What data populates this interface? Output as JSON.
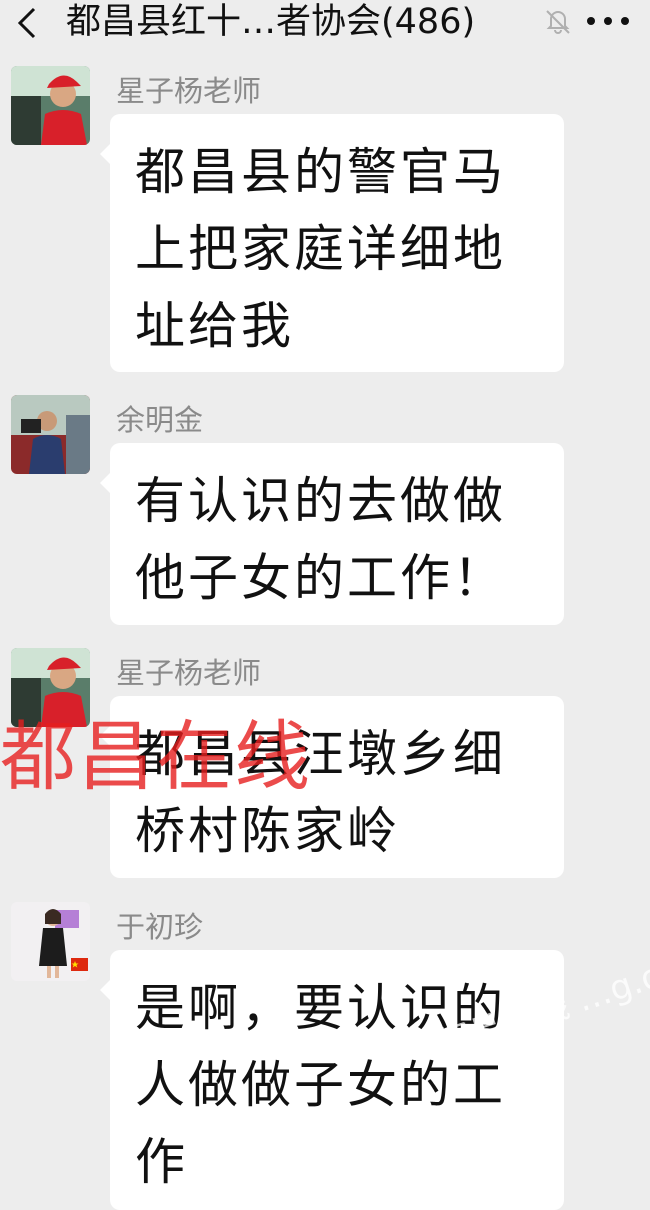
{
  "header": {
    "title": "都昌县红十…者协会(486)",
    "back_icon": "chevron-left-icon",
    "mute_icon": "bell-off-icon",
    "more_icon": "more-dots-icon"
  },
  "messages": [
    {
      "sender": "星子杨老师",
      "avatar": "avatar-man-red-cap",
      "text": "都昌县的警官马上把家庭详细地址给我"
    },
    {
      "sender": "余明金",
      "avatar": "avatar-man-camera",
      "text": "有认识的去做做他子女的工作！"
    },
    {
      "sender": "星子杨老师",
      "avatar": "avatar-man-red-cap",
      "text": "都昌县汪墩乡细桥村陈家岭"
    },
    {
      "sender": "于初珍",
      "avatar": "avatar-woman-dress",
      "text": "是啊，要认识的人做做子女的工作"
    }
  ],
  "watermarks": {
    "red_text": "都昌在线",
    "site_text": "都昌在线 …g.org"
  },
  "colors": {
    "background": "#ededed",
    "bubble": "#ffffff",
    "sender_name": "#8a8a8a",
    "watermark_red": "#e61e1e"
  }
}
